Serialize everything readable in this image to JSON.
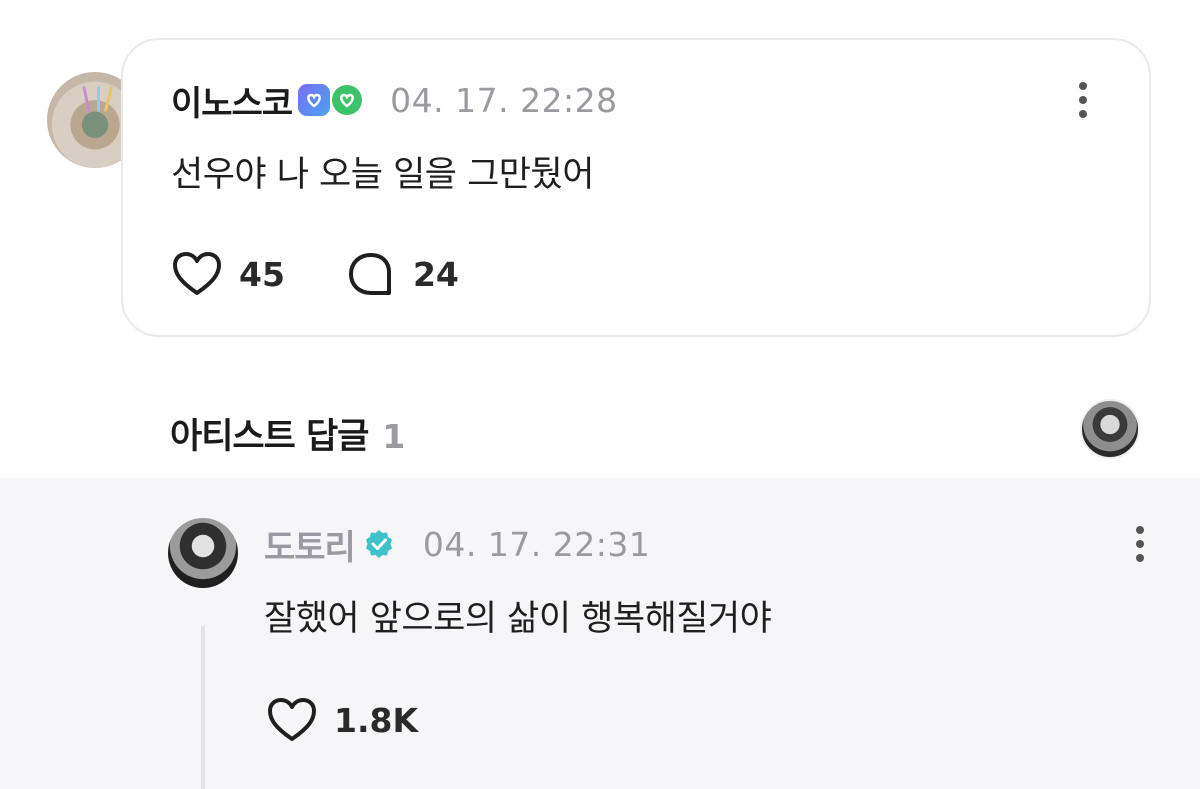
{
  "post": {
    "username": "이노스코",
    "timestamp": "04. 17. 22:28",
    "text": "선우야 나 오늘 일을 그만뒀어",
    "likes": "45",
    "comments": "24",
    "badges": [
      "fan-badge-hex-icon",
      "fan-badge-green-icon"
    ]
  },
  "artist_replies": {
    "title": "아티스트 답글",
    "count": "1"
  },
  "reply": {
    "username": "도토리",
    "timestamp": "04. 17. 22:31",
    "text": "잘했어 앞으로의 삶이 행복해질거야",
    "likes": "1.8K"
  },
  "colors": {
    "muted": "#9a9aa0",
    "verify": "#3fc1c9",
    "reply_bg": "#f6f6f8",
    "card_border": "#e9e9ec"
  }
}
